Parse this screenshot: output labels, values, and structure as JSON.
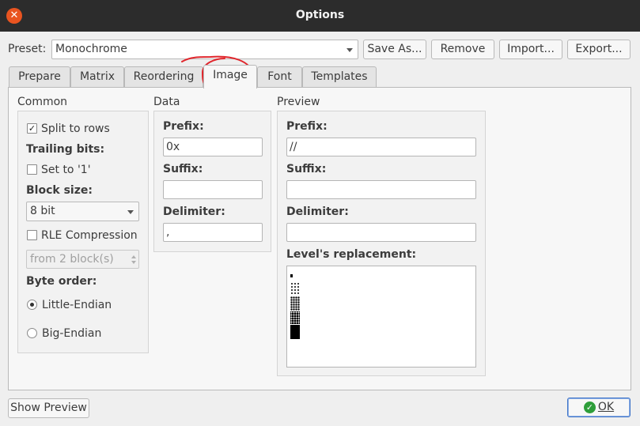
{
  "window": {
    "title": "Options"
  },
  "preset": {
    "label": "Preset:",
    "value": "Monochrome",
    "buttons": {
      "save_as": "Save As...",
      "remove": "Remove",
      "import": "Import...",
      "export": "Export..."
    }
  },
  "tabs": [
    "Prepare",
    "Matrix",
    "Reordering",
    "Image",
    "Font",
    "Templates"
  ],
  "active_tab": "Image",
  "common": {
    "title": "Common",
    "split_to_rows": "Split to rows",
    "split_to_rows_checked": true,
    "trailing_bits": "Trailing bits:",
    "set_to_1": "Set to '1'",
    "set_to_1_checked": false,
    "block_size_label": "Block size:",
    "block_size_value": "8 bit",
    "rle_compression": "RLE Compression",
    "rle_checked": false,
    "rle_from": "from 2 block(s)",
    "byte_order_label": "Byte order:",
    "little_endian": "Little-Endian",
    "big_endian": "Big-Endian",
    "byte_order_selected": "Little-Endian"
  },
  "data": {
    "title": "Data",
    "prefix_label": "Prefix:",
    "prefix_value": "0x",
    "suffix_label": "Suffix:",
    "suffix_value": "",
    "delimiter_label": "Delimiter:",
    "delimiter_value": ","
  },
  "preview": {
    "title": "Preview",
    "prefix_label": "Prefix:",
    "prefix_value": "//",
    "suffix_label": "Suffix:",
    "suffix_value": "",
    "delimiter_label": "Delimiter:",
    "delimiter_value": "",
    "levels_label": "Level's replacement:"
  },
  "footer": {
    "show_preview": "Show Preview",
    "ok": "OK"
  },
  "colors": {
    "titlebar": "#2c2c2c",
    "close": "#e95420",
    "annotation": "#e0262c",
    "ok_icon": "#2e9e3a"
  },
  "icons": {
    "close": "close-icon",
    "ok": "check-circle-icon"
  }
}
